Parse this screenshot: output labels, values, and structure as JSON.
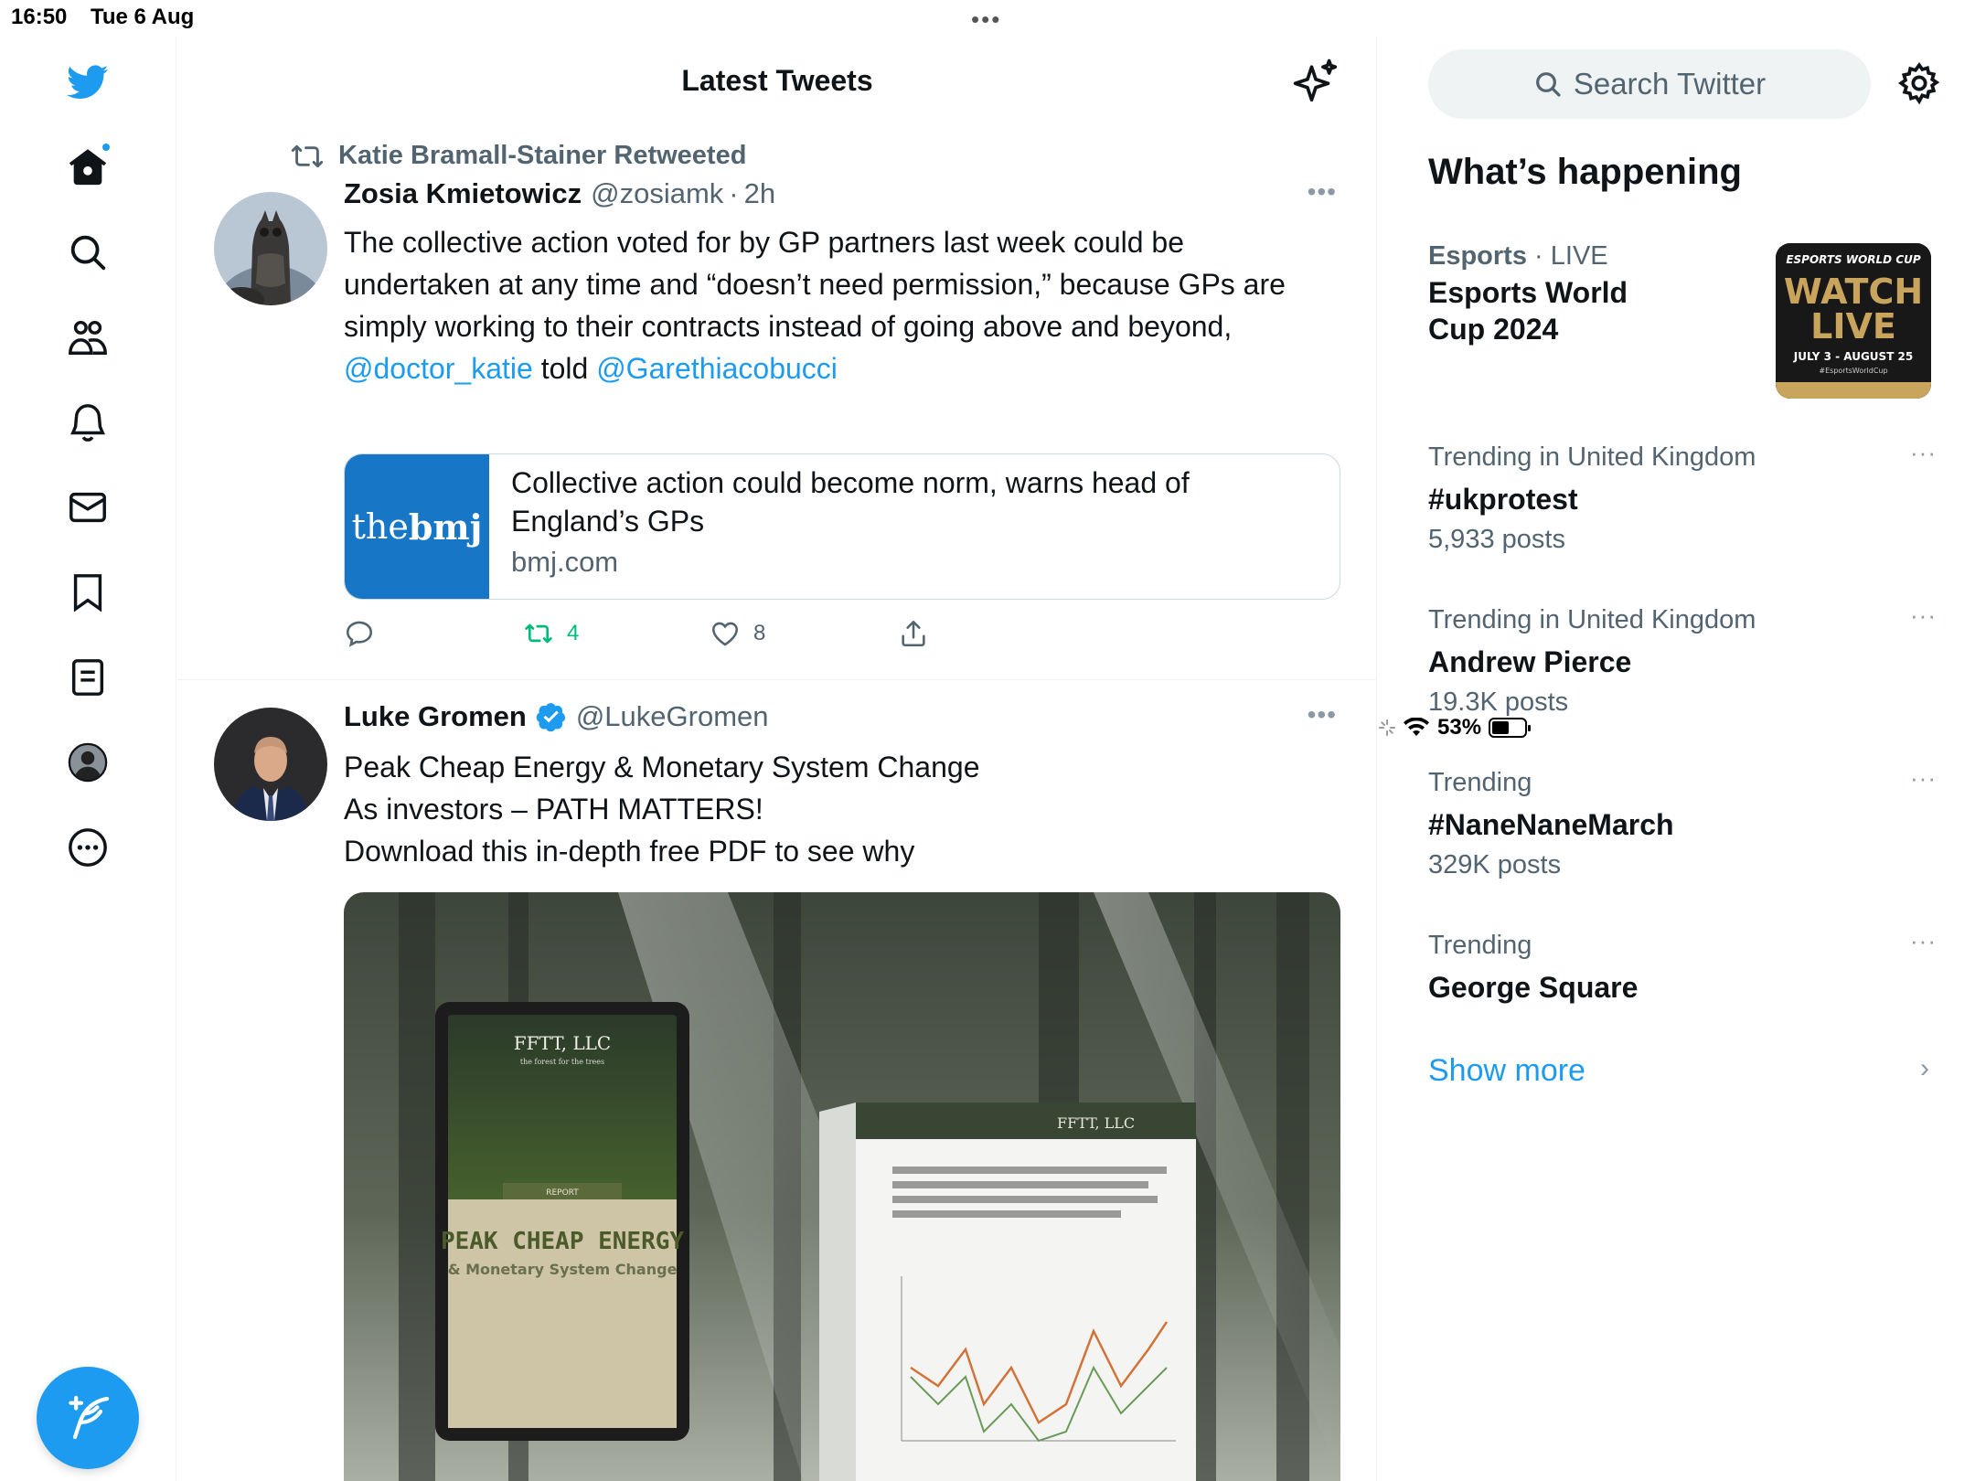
{
  "status_bar": {
    "time": "16:50",
    "date": "Tue 6 Aug",
    "battery": "53%",
    "battery_level": 0.53
  },
  "nav": {
    "items": [
      "twitter-logo",
      "home",
      "explore",
      "communities",
      "notifications",
      "messages",
      "bookmarks",
      "lists",
      "profile",
      "more"
    ],
    "compose_label": "Compose"
  },
  "main": {
    "title": "Latest Tweets",
    "tweets": [
      {
        "retweeted_by": "Katie Bramall-Stainer Retweeted",
        "name": "Zosia Kmietowicz",
        "handle": "@zosiamk",
        "sep": "·",
        "time": "2h",
        "text_before": "The collective action voted for by GP partners last week could be undertaken at any time and “doesn’t need permission,” because GPs are simply working to their contracts instead of going above and beyond, ",
        "mention1": "@doctor_katie",
        "text_middle": " told ",
        "mention2": "@Garethiacobucci",
        "card": {
          "logo_the": "the",
          "logo_bmj": "bmj",
          "title": "Collective action could become norm, warns head of England’s GPs",
          "domain": "bmj.com"
        },
        "actions": {
          "replies": "",
          "retweets": "4",
          "likes": "8"
        }
      },
      {
        "name": "Luke Gromen",
        "verified": true,
        "handle": "@LukeGromen",
        "line1": "Peak Cheap Energy & Monetary System Change",
        "line2": "As investors – PATH MATTERS!",
        "line3": "Download this in-depth free PDF to see why",
        "media": {
          "tablet_brand": "FFTT, LLC",
          "tablet_tagline": "the forest for the trees",
          "tablet_report": "REPORT",
          "tablet_title": "PEAK CHEAP ENERGY",
          "tablet_subtitle": "& Monetary System Change",
          "doc_brand": "FFTT, LLC"
        }
      }
    ]
  },
  "sidebar": {
    "search_placeholder": "Search Twitter",
    "whats_happening": "What’s happening",
    "event": {
      "category": "Esports",
      "sep": "·",
      "status": "LIVE",
      "title": "Esports World Cup 2024",
      "image_top": "ESPORTS WORLD CUP",
      "image_watch": "WATCH",
      "image_live": "LIVE",
      "image_dates": "JULY 3 - AUGUST 25",
      "image_tag": "#EsportsWorldCup"
    },
    "trends": [
      {
        "meta": "Trending in United Kingdom",
        "name": "#ukprotest",
        "count": "5,933 posts"
      },
      {
        "meta": "Trending in United Kingdom",
        "name": "Andrew Pierce",
        "count": "19.3K posts"
      },
      {
        "meta": "Trending",
        "name": "#NaneNaneMarch",
        "count": "329K posts"
      },
      {
        "meta": "Trending",
        "name": "George Square",
        "count": ""
      }
    ],
    "more_dots": "···",
    "show_more": "Show more",
    "chevron": "›"
  },
  "colors": {
    "accent": "#1d9bf0",
    "retweet_green": "#00ba7c",
    "muted": "#536471",
    "bmj_blue": "#1777c6"
  }
}
